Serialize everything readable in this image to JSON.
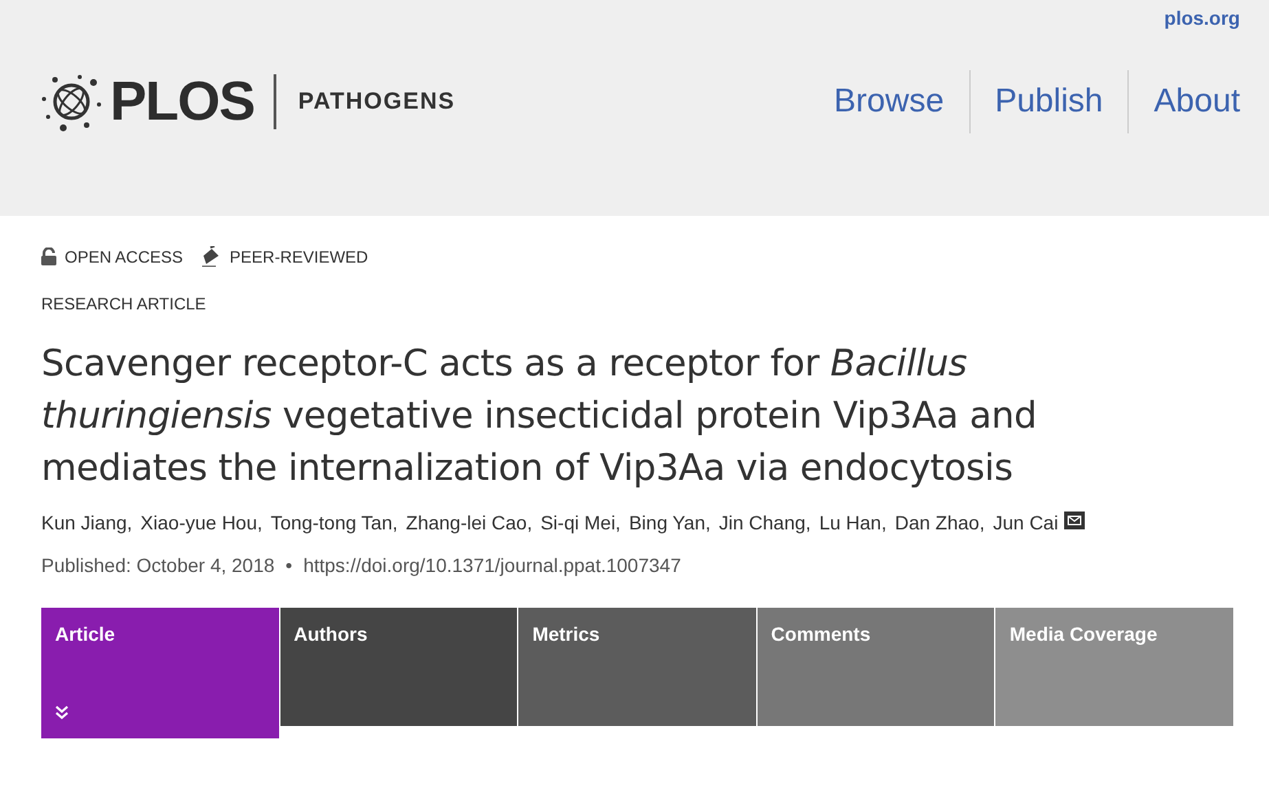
{
  "top_link": "plos.org",
  "logo": {
    "brand": "PLOS",
    "journal": "PATHOGENS"
  },
  "nav": [
    "Browse",
    "Publish",
    "About"
  ],
  "badges": [
    {
      "kind": "open",
      "label": "OPEN ACCESS"
    },
    {
      "kind": "peer",
      "label": "PEER-REVIEWED"
    }
  ],
  "article_type": "RESEARCH ARTICLE",
  "title": "Scavenger receptor-C acts as a receptor for *Bacillus thuringiensis* vegetative insecticidal protein Vip3Aa and mediates the internalization of Vip3Aa via endocytosis",
  "authors": [
    {
      "name": "Kun Jiang,",
      "corresponding": false
    },
    {
      "name": "Xiao-yue Hou,",
      "corresponding": false
    },
    {
      "name": "Tong-tong Tan,",
      "corresponding": false
    },
    {
      "name": "Zhang-lei Cao,",
      "corresponding": false
    },
    {
      "name": "Si-qi Mei,",
      "corresponding": false
    },
    {
      "name": "Bing Yan,",
      "corresponding": false
    },
    {
      "name": "Jin Chang,",
      "corresponding": false
    },
    {
      "name": "Lu Han,",
      "corresponding": false
    },
    {
      "name": "Dan Zhao,",
      "corresponding": false
    },
    {
      "name": "Jun Cai",
      "corresponding": true
    }
  ],
  "published": "Published: October 4, 2018",
  "separator": "•",
  "doi": "https://doi.org/10.1371/journal.ppat.1007347",
  "tabs": [
    {
      "label": "Article",
      "selected": true,
      "color": "#891dae"
    },
    {
      "label": "Authors",
      "selected": false,
      "color": "#454545"
    },
    {
      "label": "Metrics",
      "selected": false,
      "color": "#5c5c5c"
    },
    {
      "label": "Comments",
      "selected": false,
      "color": "#777777"
    },
    {
      "label": "Media Coverage",
      "selected": false,
      "color": "#8e8e8e"
    }
  ]
}
